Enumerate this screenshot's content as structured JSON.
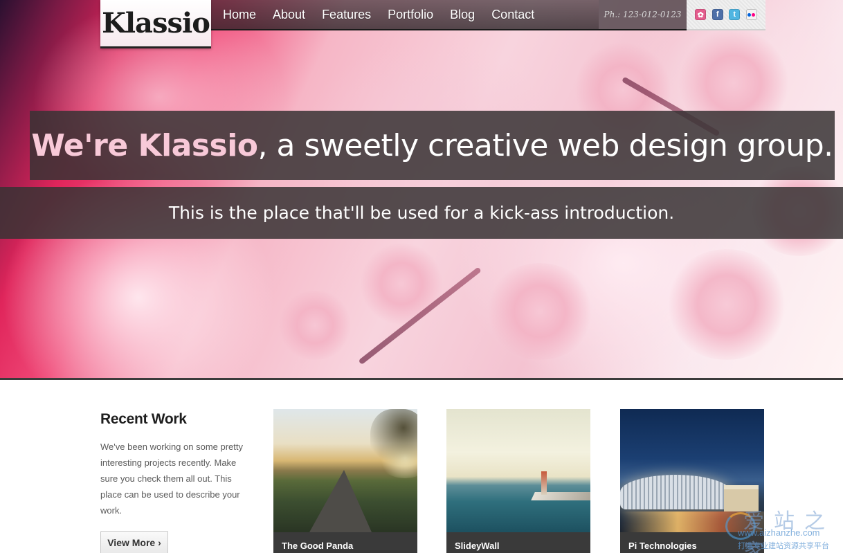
{
  "site": {
    "logo": "Klassio"
  },
  "nav": {
    "items": [
      {
        "label": "Home"
      },
      {
        "label": "About"
      },
      {
        "label": "Features"
      },
      {
        "label": "Portfolio"
      },
      {
        "label": "Blog"
      },
      {
        "label": "Contact"
      }
    ],
    "phone": "Ph.: 123-012-0123",
    "social": [
      {
        "icon": "dribbble-icon",
        "color": "#e45c8d"
      },
      {
        "icon": "facebook-icon",
        "color": "#4d6fa8"
      },
      {
        "icon": "twitter-icon",
        "color": "#4fb5e1"
      },
      {
        "icon": "flickr-icon",
        "color": "#0063dc"
      }
    ]
  },
  "hero": {
    "headline_strong": "We're Klassio",
    "headline_rest": ", a sweetly creative web design group.",
    "subhead": "This is the place that'll be used for a kick-ass introduction."
  },
  "recent_work": {
    "title": "Recent Work",
    "description": "We've been working on some pretty interesting projects recently. Make sure you check them all out. This place can be used to describe your work.",
    "button": "View More ›",
    "items": [
      {
        "label": "The Good Panda"
      },
      {
        "label": "SlideyWall"
      },
      {
        "label": "Pi Technologies"
      }
    ]
  },
  "watermark": {
    "cn": "爱站之家",
    "url": "www.aizhanzhe.com",
    "sub": "打造专业建站资源共享平台"
  },
  "colors": {
    "accent_pink": "#f8c9d8",
    "band_dark": "#373234",
    "label_dark": "#3a3a3a"
  }
}
